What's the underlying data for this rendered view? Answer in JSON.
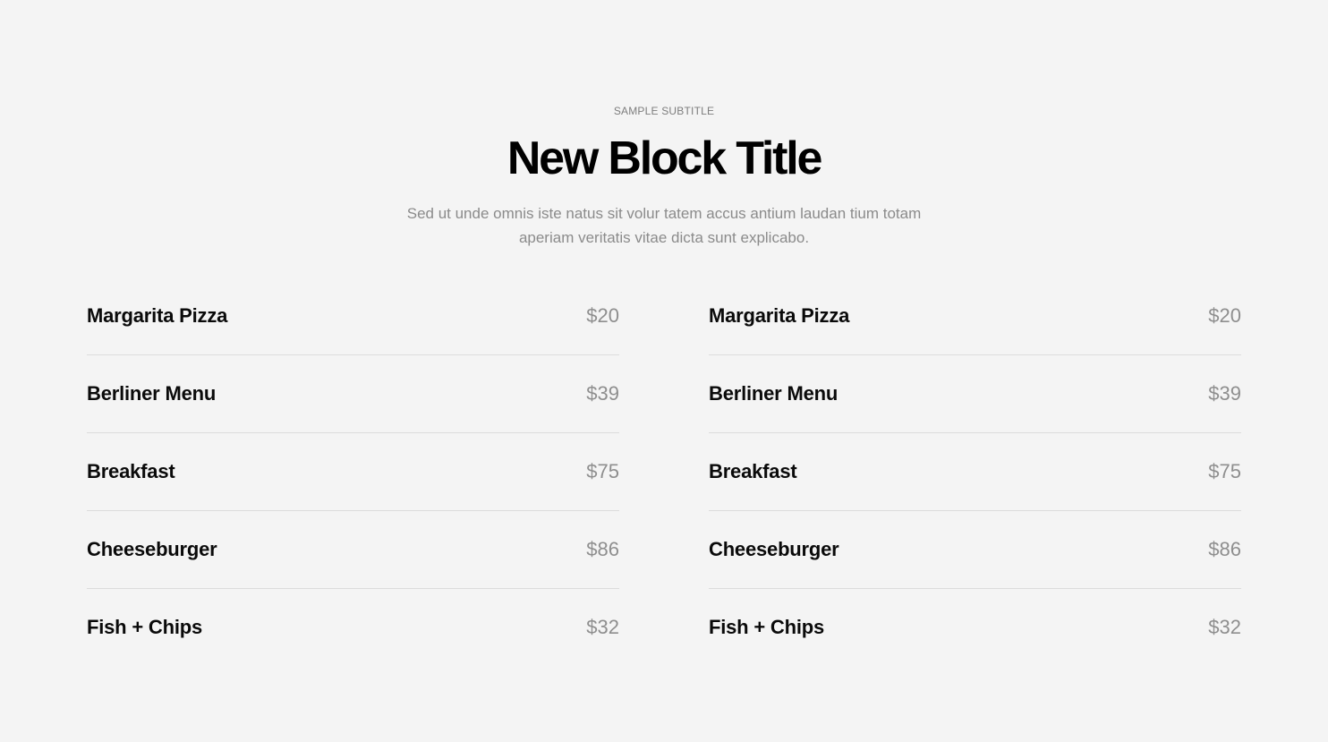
{
  "header": {
    "subtitle": "SAMPLE SUBTITLE",
    "title": "New Block Title",
    "description": "Sed ut unde omnis iste natus sit volur tatem accus antium laudan tium totam aperiam veritatis vitae dicta sunt explicabo."
  },
  "menu_left": [
    {
      "name": "Margarita Pizza",
      "price": "$20"
    },
    {
      "name": "Berliner Menu",
      "price": "$39"
    },
    {
      "name": "Breakfast",
      "price": "$75"
    },
    {
      "name": "Cheeseburger",
      "price": "$86"
    },
    {
      "name": "Fish + Chips",
      "price": "$32"
    }
  ],
  "menu_right": [
    {
      "name": "Margarita Pizza",
      "price": "$20"
    },
    {
      "name": "Berliner Menu",
      "price": "$39"
    },
    {
      "name": "Breakfast",
      "price": "$75"
    },
    {
      "name": "Cheeseburger",
      "price": "$86"
    },
    {
      "name": "Fish + Chips",
      "price": "$32"
    }
  ],
  "colors": {
    "background": "#f4f4f4",
    "title": "#000000",
    "muted_text": "#8b8b8b",
    "divider": "#dcdcdc"
  }
}
